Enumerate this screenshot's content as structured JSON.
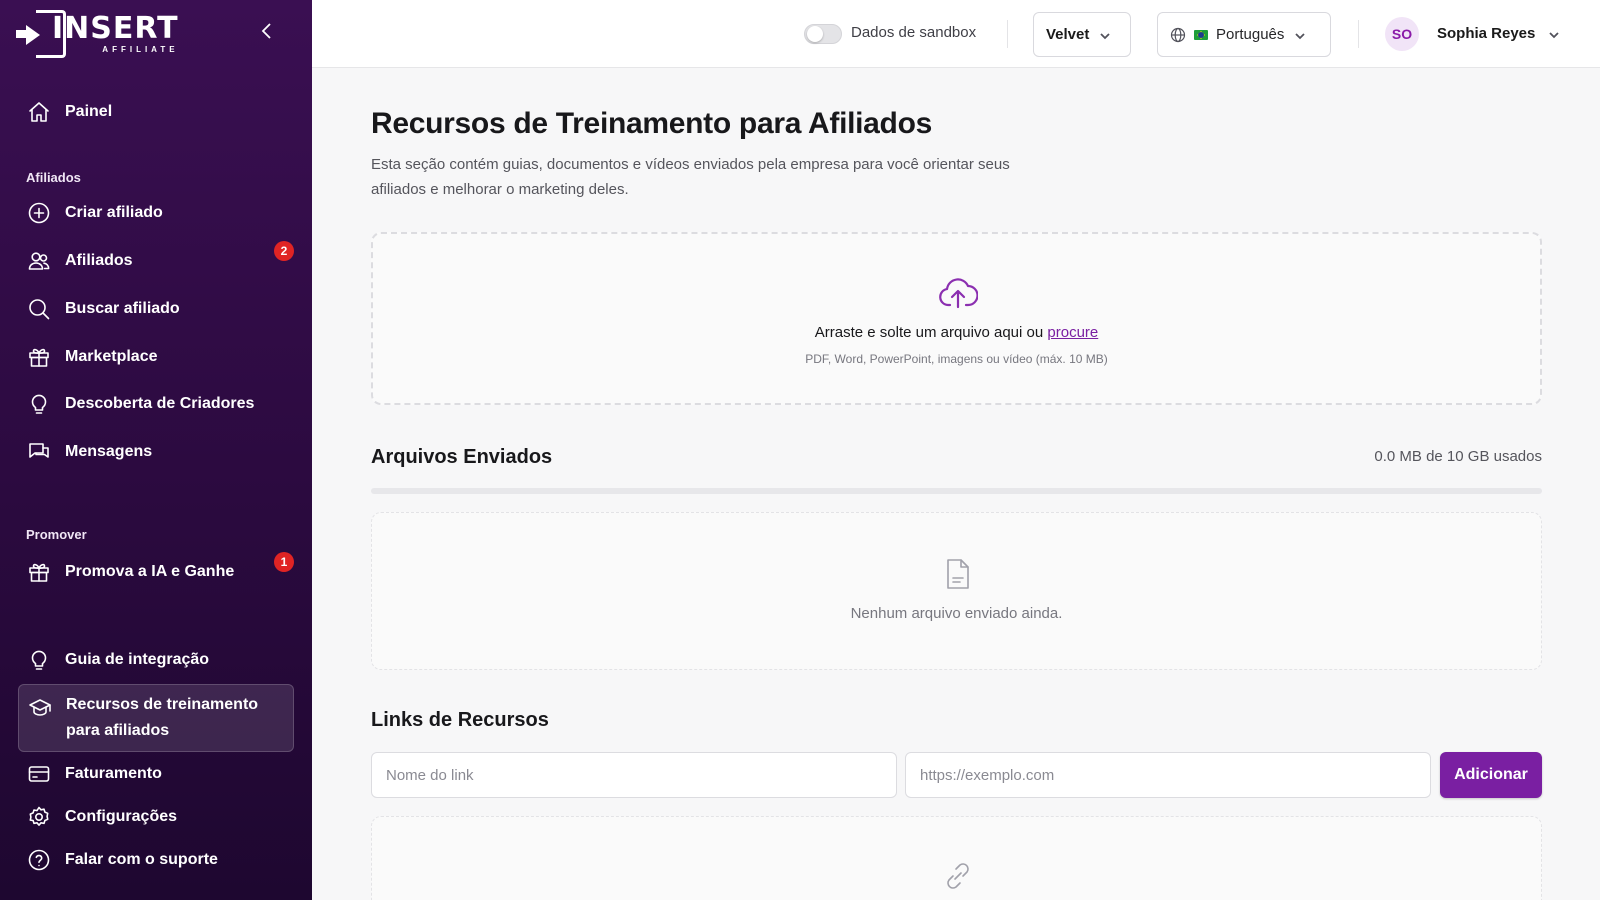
{
  "brand": {
    "name": "INSERT",
    "tagline": "AFFILIATE"
  },
  "sidebar": {
    "items": [
      {
        "label": "Painel",
        "icon": "home-icon"
      },
      {
        "label": "Criar afiliado",
        "icon": "plus-circle-icon"
      },
      {
        "label": "Afiliados",
        "icon": "users-icon",
        "badge": "2"
      },
      {
        "label": "Buscar afiliado",
        "icon": "search-icon"
      },
      {
        "label": "Marketplace",
        "icon": "gift-icon"
      },
      {
        "label": "Descoberta de Criadores",
        "icon": "lightbulb-icon"
      },
      {
        "label": "Mensagens",
        "icon": "chat-icon"
      },
      {
        "label": "Promova a IA e Ganhe",
        "icon": "gift-icon",
        "badge": "1"
      },
      {
        "label": "Guia de integração",
        "icon": "lightbulb-icon"
      },
      {
        "label": "Recursos de treinamento para afiliados",
        "icon": "graduation-cap-icon",
        "active": true
      },
      {
        "label": "Faturamento",
        "icon": "credit-card-icon"
      },
      {
        "label": "Configurações",
        "icon": "gear-icon"
      },
      {
        "label": "Falar com o suporte",
        "icon": "help-circle-icon"
      }
    ],
    "sections": {
      "affiliates": "Afiliados",
      "promote": "Promover"
    }
  },
  "topbar": {
    "sandbox_label": "Dados de sandbox",
    "sandbox_on": false,
    "workspace": "Velvet",
    "language": "Português",
    "user_initials": "SO",
    "user_name": "Sophia Reyes"
  },
  "main": {
    "title": "Recursos de Treinamento para Afiliados",
    "description": "Esta seção contém guias, documentos e vídeos enviados pela empresa para você orientar seus afiliados e melhorar o marketing deles.",
    "dropzone": {
      "text": "Arraste e solte um arquivo aqui ou",
      "link": "procure",
      "hint": "PDF, Word, PowerPoint, imagens ou vídeo (máx. 10 MB)"
    },
    "uploaded": {
      "heading": "Arquivos Enviados",
      "storage": "0.0 MB de 10 GB usados",
      "usage_fraction": 0,
      "empty": "Nenhum arquivo enviado ainda."
    },
    "links": {
      "heading": "Links de Recursos",
      "name_placeholder": "Nome do link",
      "url_placeholder": "https://exemplo.com",
      "add_label": "Adicionar"
    }
  },
  "colors": {
    "accent": "#7a1fa2",
    "sidebar_bg": "#3a0f52",
    "badge": "#e02424"
  }
}
